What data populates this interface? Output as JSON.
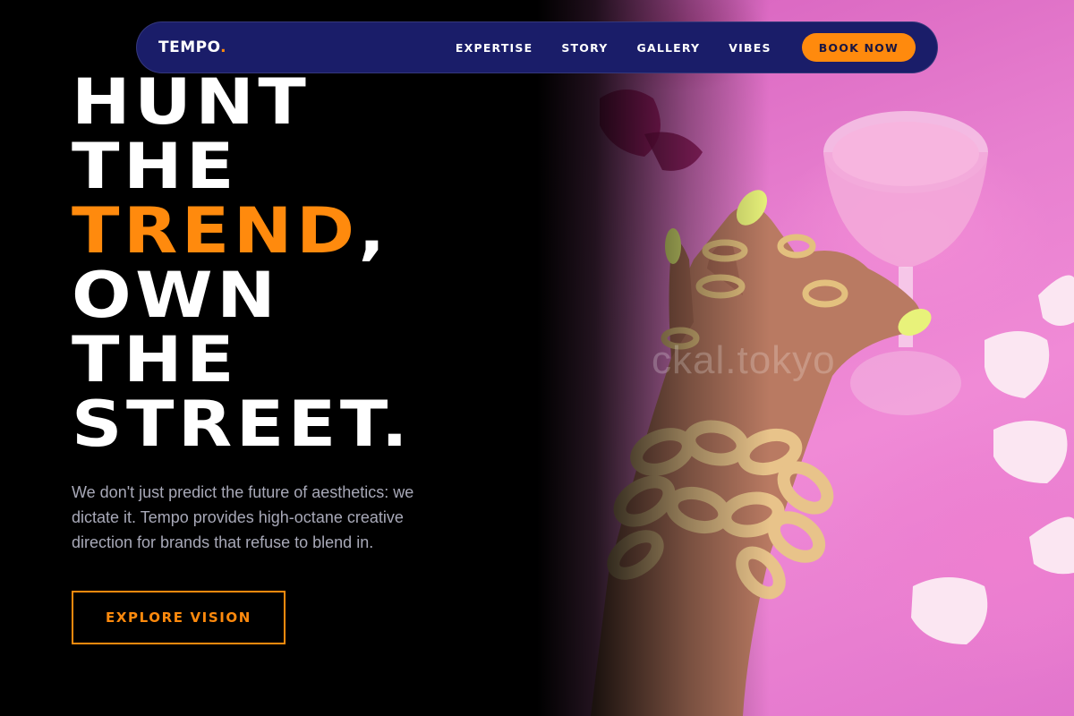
{
  "brand": {
    "name": "TEMPO",
    "dot": "."
  },
  "nav": {
    "links": [
      "EXPERTISE",
      "STORY",
      "GALLERY",
      "VIBES"
    ],
    "cta": "BOOK NOW"
  },
  "hero": {
    "headline": [
      {
        "text": "HUNT",
        "accent": "",
        "suffix": ""
      },
      {
        "text": "THE",
        "accent": "",
        "suffix": ""
      },
      {
        "text": "",
        "accent": "TREND",
        "suffix": ","
      },
      {
        "text": "OWN",
        "accent": "",
        "suffix": ""
      },
      {
        "text": "THE",
        "accent": "",
        "suffix": ""
      },
      {
        "text": "STREET.",
        "accent": "",
        "suffix": ""
      }
    ],
    "lead": "We don't just predict the future of aesthetics: we dictate it. Tempo provides high-octane creative direction for brands that refuse to blend in.",
    "cta": "EXPLORE VISION",
    "image_watermark": "ckal.tokyo"
  },
  "colors": {
    "background": "#000000",
    "nav_bg": "#1a1d69",
    "accent": "#ff8a0d",
    "text": "#ffffff",
    "muted_text": "#a8a9b8"
  }
}
